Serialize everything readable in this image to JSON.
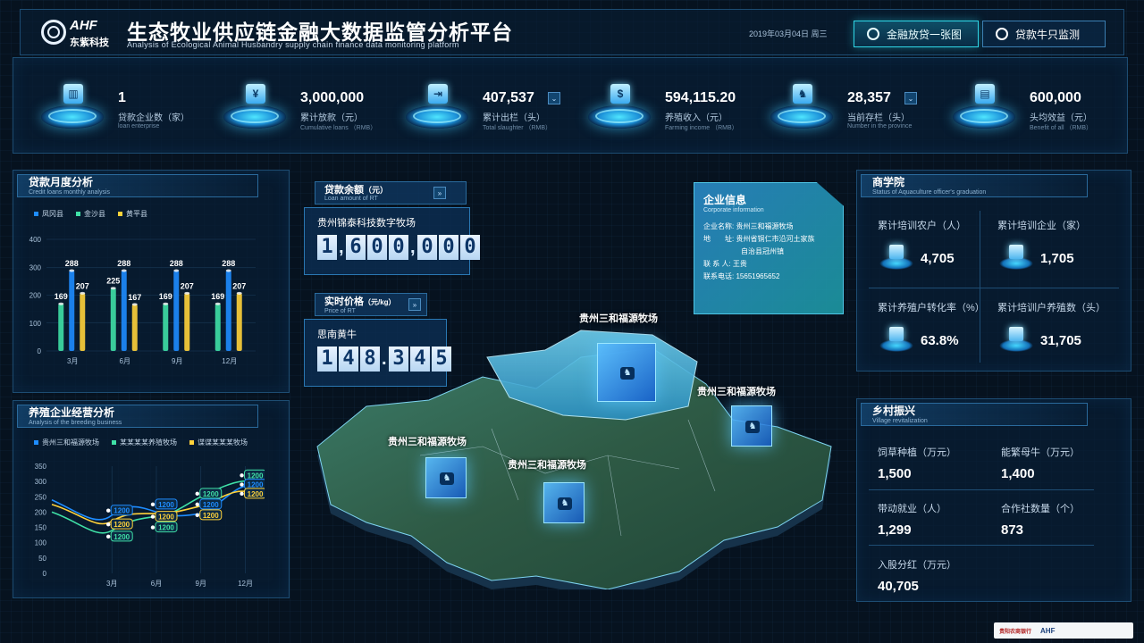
{
  "header": {
    "logo_text": "AHF",
    "logo_sub": "东紫科技",
    "title": "生态牧业供应链金融大数据监管分析平台",
    "title_en": "Analysis of Ecological Animal Husbandry supply chain finance data monitoring platform",
    "date": "2019年03月04日   周三",
    "btn_loans": "金融放贷一张图",
    "btn_cattle": "贷款牛只监测"
  },
  "stats": [
    {
      "icon": "building-icon",
      "value": "1",
      "label": "贷款企业数（家）",
      "en": "loan enterprise"
    },
    {
      "icon": "yuan-download-icon",
      "value": "3,000,000",
      "label": "累计放款（元）",
      "en": "Cumulative loans  （RMB）"
    },
    {
      "icon": "export-icon",
      "value": "407,537",
      "label": "累计出栏（头）",
      "en": "Total slaughter  （RMB）",
      "dropdown": "⌄"
    },
    {
      "icon": "money-bag-icon",
      "value": "594,115.20",
      "label": "养殖收入（元）",
      "en": "Farming income  （RMB）"
    },
    {
      "icon": "cattle-icon",
      "value": "28,357",
      "label": "当前存栏（头）",
      "en": "Number in the province",
      "dropdown": "⌄"
    },
    {
      "icon": "chart-icon",
      "value": "600,000",
      "label": "头均效益（元）",
      "en": "Benefit of all  （RMB）"
    }
  ],
  "loan_chart_panel": {
    "title": "贷款月度分析",
    "subtitle": "Credit loans monthly analysis"
  },
  "breeding_panel": {
    "title": "养殖企业经营分析",
    "subtitle": "Analysis of the breeding business"
  },
  "chart_data": [
    {
      "type": "bar",
      "categories": [
        "3月",
        "6月",
        "9月",
        "12月"
      ],
      "series": [
        {
          "name": "凤冈县",
          "values": [
            288,
            288,
            288,
            288
          ],
          "color": "#1e8cff"
        },
        {
          "name": "金沙县",
          "values": [
            169,
            225,
            169,
            169
          ],
          "color": "#3fe0a6"
        },
        {
          "name": "黄平县",
          "values": [
            207,
            167,
            207,
            207
          ],
          "color": "#ffd23a"
        }
      ],
      "yticks": [
        0,
        100,
        200,
        300,
        400
      ],
      "ylim": [
        0,
        400
      ]
    },
    {
      "type": "line",
      "categories": [
        "3月",
        "6月",
        "9月",
        "12月"
      ],
      "series": [
        {
          "name": "贵州三和福源牧场",
          "color": "#1e8cff"
        },
        {
          "name": "某某某某养殖牧场",
          "color": "#3fe0a6"
        },
        {
          "name": "谍谍某某某牧场",
          "color": "#ffd23a"
        }
      ],
      "yticks": [
        0,
        50,
        100,
        150,
        200,
        250,
        300,
        350
      ],
      "ylim": [
        0,
        350
      ],
      "labels": [
        {
          "text": "1200",
          "color": "#1e8cff",
          "x": 1,
          "y": 205
        },
        {
          "text": "1200",
          "color": "#ffd23a",
          "x": 1,
          "y": 160
        },
        {
          "text": "1200",
          "color": "#3fe0a6",
          "x": 1,
          "y": 120
        },
        {
          "text": "1200",
          "color": "#1e8cff",
          "x": 2,
          "y": 225
        },
        {
          "text": "1200",
          "color": "#ffd23a",
          "x": 2,
          "y": 185
        },
        {
          "text": "1200",
          "color": "#3fe0a6",
          "x": 2,
          "y": 150
        },
        {
          "text": "1200",
          "color": "#3fe0a6",
          "x": 3,
          "y": 260
        },
        {
          "text": "1200",
          "color": "#1e8cff",
          "x": 3,
          "y": 225
        },
        {
          "text": "1200",
          "color": "#ffd23a",
          "x": 3,
          "y": 190
        },
        {
          "text": "1200",
          "color": "#3fe0a6",
          "x": 4,
          "y": 320
        },
        {
          "text": "1200",
          "color": "#1e8cff",
          "x": 4,
          "y": 290
        },
        {
          "text": "1200",
          "color": "#ffd23a",
          "x": 4,
          "y": 260
        }
      ]
    }
  ],
  "loan_balance": {
    "title": "贷款余额",
    "unit": "（元）",
    "en": "Loan amount of RT",
    "company": "贵州锦泰科技数字牧场",
    "digits": [
      "1",
      ",",
      "6",
      "0",
      "0",
      ",",
      "0",
      "0",
      "0"
    ]
  },
  "realtime_price": {
    "title": "实时价格",
    "unit": "（元/kg）",
    "en": "Price of RT",
    "item": "思南黄牛",
    "digits": [
      "1",
      "4",
      "8",
      ".",
      "3",
      "4",
      "5"
    ]
  },
  "enterprise_info": {
    "title": "企业信息",
    "en": "Corporate information",
    "name_label": "企业名称:",
    "name": "贵州三和福源牧场",
    "addr_label": "地　　址:",
    "addr1": "贵州省铜仁市沿河土家族",
    "addr2": "自治县冠州镇",
    "contact_label": "联  系  人:",
    "contact": "王贵",
    "phone_label": "联系电话:",
    "phone": "15651965652"
  },
  "map_markers": [
    {
      "label": "贵州三和福源牧场"
    },
    {
      "label": "贵州三和福源牧场"
    },
    {
      "label": "贵州三和福源牧场"
    },
    {
      "label": "贵州三和福源牧场"
    }
  ],
  "academy": {
    "title": "商学院",
    "en": "Status of Aquaculture officer's graduation",
    "items": [
      {
        "label": "累计培训农户（人）",
        "value": "4,705"
      },
      {
        "label": "累计培训企业（家）",
        "value": "1,705"
      },
      {
        "label": "累计养殖户转化率（%）",
        "value": "63.8%"
      },
      {
        "label": "累计培训户养殖数（头）",
        "value": "31,705"
      }
    ]
  },
  "revival": {
    "title": "乡村振兴",
    "en": "Village revitalization",
    "items": [
      {
        "label": "饲草种植（万元）",
        "value": "1,500"
      },
      {
        "label": "能繁母牛（万元）",
        "value": "1,400"
      },
      {
        "label": "带动就业（人）",
        "value": "1,299"
      },
      {
        "label": "合作社数量（个）",
        "value": "873"
      },
      {
        "label": "入股分红（万元）",
        "value": "40,705"
      }
    ]
  },
  "footer": {
    "bank": "贵阳农商银行",
    "brand": "AHF"
  }
}
